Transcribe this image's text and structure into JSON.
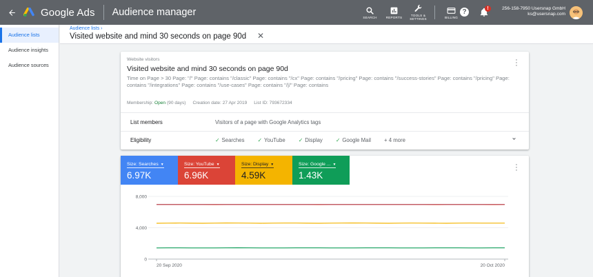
{
  "topbar": {
    "back_icon": "arrow-left-icon",
    "brand": "Google Ads",
    "app_title": "Audience manager",
    "tools": [
      {
        "label": "SEARCH",
        "icon": "search-icon"
      },
      {
        "label": "REPORTS",
        "icon": "bar-chart-icon"
      },
      {
        "label": "TOOLS & SETTINGS",
        "icon": "wrench-icon"
      },
      {
        "label": "BILLING",
        "icon": "credit-card-icon"
      }
    ],
    "help_label": "?",
    "notification_count": "!",
    "account_id": "256-158-7950 Usersnap GmbH",
    "account_email": "ks@usersnap.com"
  },
  "sidebar": {
    "items": [
      {
        "label": "Audience lists",
        "active": true
      },
      {
        "label": "Audience insights",
        "active": false
      },
      {
        "label": "Audience sources",
        "active": false
      }
    ]
  },
  "header": {
    "breadcrumb": "Audience lists",
    "breadcrumb_sep": "›",
    "title": "Visited website and mind 30 seconds on page 90d"
  },
  "details": {
    "subtitle": "Website visitors",
    "title": "Visited website and mind 30 seconds on page 90d",
    "description": "Time on Page > 30 Page: \"/\" Page: contains \"/classic\" Page: contains \"/cx\" Page: contains \"/pricing\" Page: contains \"/success-stories\" Page: contains \"/pricing\" Page: contains \"/integrations\" Page: contains \"/use-cases\" Page: contains \"/|/\" Page: contains",
    "membership_label": "Membership:",
    "membership_status": "Open",
    "membership_duration": "(90 days)",
    "creation_label": "Creation date:",
    "creation_date": "27 Apr 2019",
    "list_id_label": "List ID:",
    "list_id": "793672334",
    "list_members_label": "List members",
    "list_members_value": "Visitors of a page with Google Analytics tags",
    "eligibility_label": "Eligibility",
    "eligibility_items": [
      "Searches",
      "YouTube",
      "Display",
      "Google Mail"
    ],
    "eligibility_more": "+ 4 more"
  },
  "size_tiles": [
    {
      "label": "Size: Searches",
      "value": "6.97K",
      "color": "#4285f4"
    },
    {
      "label": "Size: YouTube",
      "value": "6.96K",
      "color": "#db4437"
    },
    {
      "label": "Size: Display",
      "value": "4.59K",
      "color": "#f4b400",
      "dark_text": true
    },
    {
      "label": "Size: Google ...",
      "value": "1.43K",
      "color": "#0f9d58"
    }
  ],
  "chart_data": {
    "type": "line",
    "x_labels": [
      "20 Sep 2020",
      "20 Oct 2020"
    ],
    "y_ticks": [
      "0",
      "4,000",
      "8,000"
    ],
    "ylim": [
      0,
      8000
    ],
    "grid": true,
    "series": [
      {
        "name": "Searches",
        "color": "#4285f4",
        "values": [
          6970,
          6975,
          6972,
          6970,
          6975,
          6968,
          6970,
          6972,
          6975,
          6970,
          6969,
          6972,
          6974,
          6970,
          6968,
          6971,
          6973,
          6970,
          6972,
          6970,
          6969,
          6971,
          6973,
          6970,
          6968,
          6970,
          6972,
          6971,
          6970,
          6970,
          6970
        ]
      },
      {
        "name": "YouTube",
        "color": "#db4437",
        "values": [
          6960,
          6965,
          6962,
          6960,
          6966,
          6958,
          6960,
          6963,
          6966,
          6960,
          6959,
          6962,
          6964,
          6960,
          6958,
          6961,
          6963,
          6960,
          6962,
          6960,
          6959,
          6961,
          6963,
          6960,
          6958,
          6960,
          6962,
          6961,
          6960,
          6955,
          6960
        ]
      },
      {
        "name": "Display",
        "color": "#f4b400",
        "values": [
          4570,
          4590,
          4600,
          4580,
          4570,
          4590,
          4610,
          4600,
          4585,
          4575,
          4590,
          4600,
          4595,
          4580,
          4570,
          4585,
          4600,
          4610,
          4595,
          4580,
          4575,
          4590,
          4600,
          4590,
          4580,
          4575,
          4585,
          4595,
          4590,
          4585,
          4590
        ]
      },
      {
        "name": "Google Mail",
        "color": "#0f9d58",
        "values": [
          1420,
          1430,
          1435,
          1425,
          1420,
          1428,
          1432,
          1438,
          1430,
          1425,
          1420,
          1428,
          1432,
          1435,
          1430,
          1425,
          1422,
          1428,
          1433,
          1436,
          1430,
          1425,
          1420,
          1428,
          1432,
          1434,
          1430,
          1426,
          1428,
          1430,
          1430
        ]
      }
    ]
  }
}
